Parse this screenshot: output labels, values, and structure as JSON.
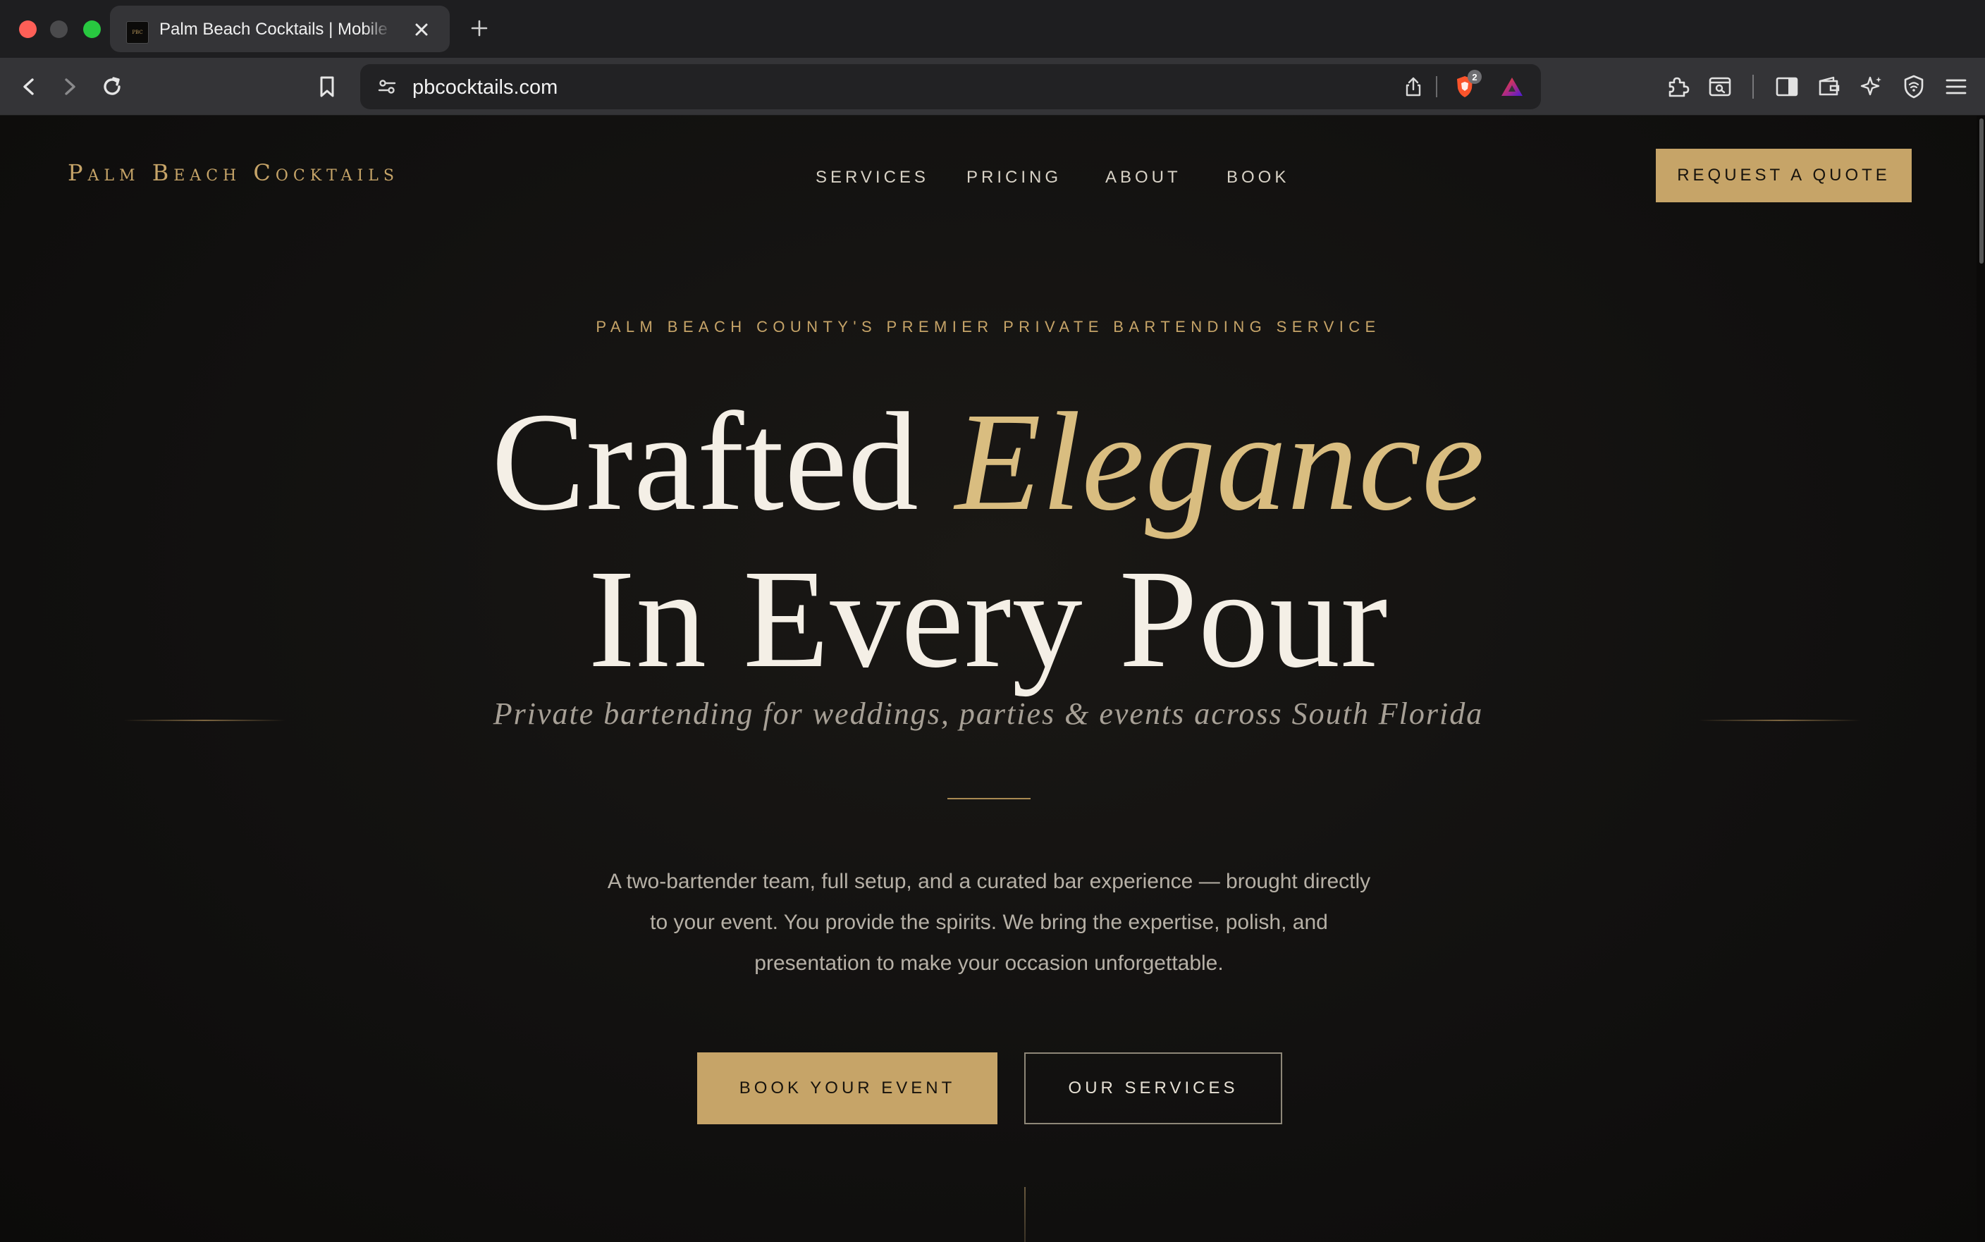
{
  "browser": {
    "tab_title": "Palm Beach Cocktails | Mobile Bartending",
    "tab_favicon_text": "PBC",
    "url": "pbcocktails.com",
    "shields_count": "2",
    "colors": {
      "chrome_dark": "#1e1e20",
      "chrome_light": "#343437",
      "close": "#fe5f57",
      "zoom": "#28c840"
    }
  },
  "site": {
    "logo": "Palm Beach Cocktails",
    "nav": [
      "SERVICES",
      "PRICING",
      "ABOUT",
      "BOOK"
    ],
    "quote_button": "REQUEST A QUOTE",
    "colors": {
      "gold": "#c6a468",
      "gold_light": "#d9bd80",
      "background": "#0e0d0c",
      "heading": "#f4efe6"
    }
  },
  "hero": {
    "eyebrow": "PALM BEACH COUNTY'S PREMIER PRIVATE BARTENDING SERVICE",
    "headline_1_plain": "Crafted ",
    "headline_1_accent": "Elegance",
    "headline_2": "In Every Pour",
    "subtitle": "Private bartending for weddings, parties & events across South Florida",
    "body": "A two-bartender team, full setup, and a curated bar experience — brought directly to your event. You provide the spirits. We bring the expertise, polish, and presentation to make your occasion unforgettable.",
    "primary_button": "BOOK YOUR EVENT",
    "secondary_button": "OUR SERVICES"
  }
}
